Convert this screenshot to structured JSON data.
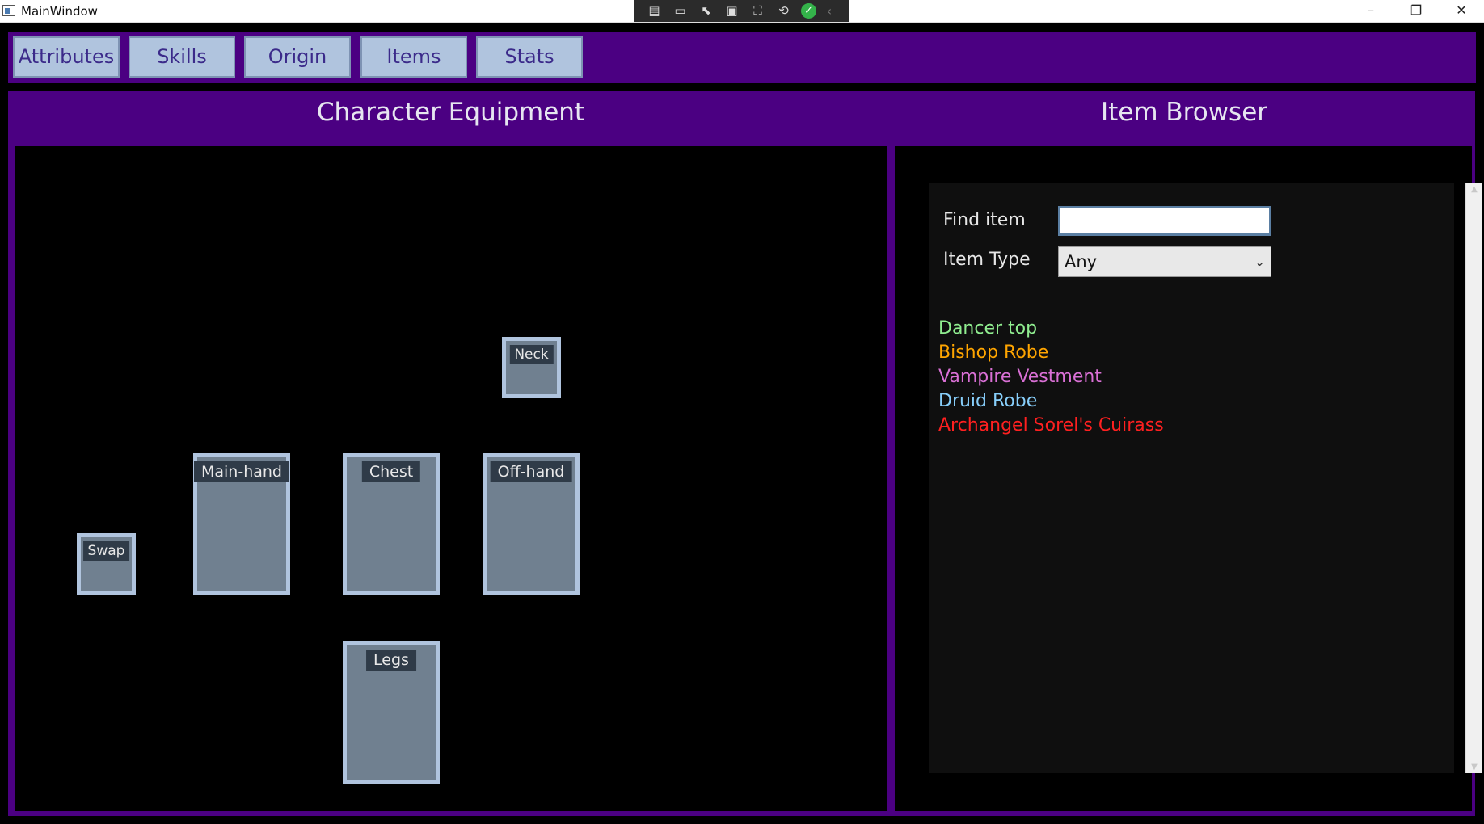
{
  "window": {
    "title": "MainWindow",
    "controls": [
      "–",
      "❐",
      "✕"
    ]
  },
  "nav": {
    "tabs": [
      "Attributes",
      "Skills",
      "Origin",
      "Items",
      "Stats"
    ]
  },
  "equipment": {
    "title": "Character Equipment",
    "slots": {
      "neck": "Neck",
      "main_hand": "Main-hand",
      "chest": "Chest",
      "off_hand": "Off-hand",
      "swap": "Swap",
      "legs": "Legs"
    }
  },
  "browser": {
    "title": "Item Browser",
    "find_label": "Find item",
    "find_value": "",
    "type_label": "Item Type",
    "type_value": "Any",
    "items": [
      {
        "name": "Dancer top",
        "color": "#90ee90"
      },
      {
        "name": "Bishop Robe",
        "color": "#ffa500"
      },
      {
        "name": "Vampire Vestment",
        "color": "#da70d6"
      },
      {
        "name": "Druid Robe",
        "color": "#87cefa"
      },
      {
        "name": "Archangel Sorel's Cuirass",
        "color": "#ff2020"
      }
    ]
  }
}
